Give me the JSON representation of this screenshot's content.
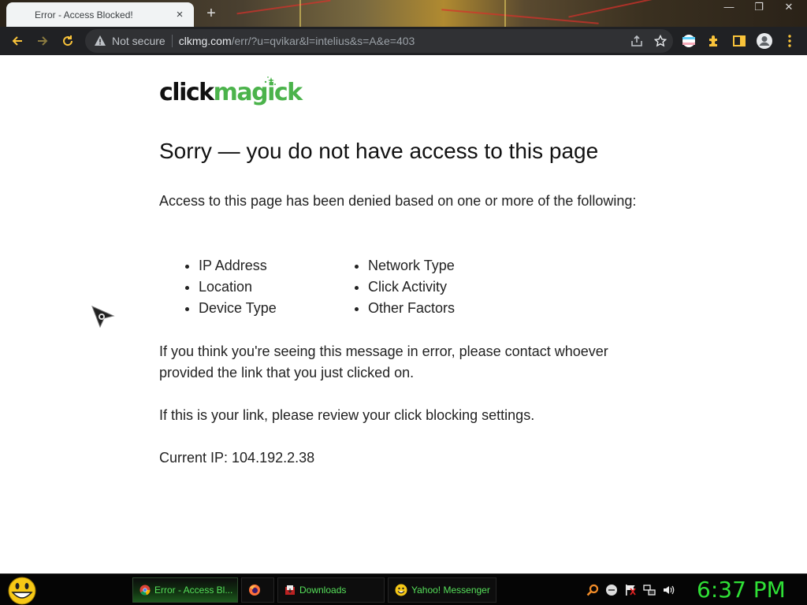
{
  "browser": {
    "tab_title": "Error - Access Blocked!",
    "tab_close": "×",
    "new_tab": "+",
    "window_controls": [
      "—",
      "❐",
      "✕"
    ],
    "security_label": "Not secure",
    "url_host": "clkmg.com",
    "url_path": "/err/?u=qvikar&l=intelius&s=A&e=403",
    "nav_icons": [
      "back-arrow-icon",
      "forward-arrow-icon",
      "reload-icon"
    ],
    "toolbar_icons": [
      "share-icon",
      "star-icon",
      "profile-flag-icon",
      "extensions-icon",
      "side-panel-icon",
      "account-icon",
      "menu-icon"
    ]
  },
  "page": {
    "logo_dark": "click",
    "logo_green": "magick",
    "heading": "Sorry — you do not have access to this page",
    "intro": "Access to this page has been denied based on one or more of the following:",
    "factors_left": [
      "IP Address",
      "Location",
      "Device Type"
    ],
    "factors_right": [
      "Network Type",
      "Click Activity",
      "Other Factors"
    ],
    "error_note": "If you think you're seeing this message in error, please contact whoever provided the link that you just clicked on.",
    "owner_note": "If this is your link, please review your click blocking settings.",
    "current_ip": "Current IP: 104.192.2.38"
  },
  "taskbar": {
    "tasks": [
      {
        "label": "Error - Access Bl...",
        "icon": "chrome-icon",
        "active": true
      },
      {
        "label": "",
        "icon": "firefox-icon",
        "active": false
      },
      {
        "label": "Downloads",
        "icon": "folder-icon",
        "active": false
      },
      {
        "label": "Yahoo! Messenger",
        "icon": "yahoo-messenger-icon",
        "active": false
      }
    ],
    "tray_icons": [
      "search-icon",
      "messenger-tray-icon",
      "flag-icon",
      "network-icon",
      "volume-icon"
    ],
    "clock": "6:37 PM"
  },
  "colors": {
    "brand_green": "#4bb34b",
    "clock_green": "#2fe036",
    "task_text_green": "#56e05a",
    "nav_yellow": "#f9c33a"
  }
}
